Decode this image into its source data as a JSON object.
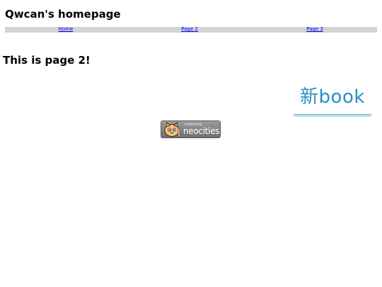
{
  "site": {
    "title": "Qwcan's homepage"
  },
  "nav": {
    "items": [
      {
        "label": "Home"
      },
      {
        "label": "Page 2"
      },
      {
        "label": "Page 3"
      }
    ]
  },
  "main": {
    "heading": "This is page 2!"
  },
  "banner": {
    "text": "新book",
    "color": "#2a8fc4"
  },
  "badge": {
    "hosted_by": "hosted by",
    "name": "neocities",
    "icon": "neocities-cat-icon"
  }
}
